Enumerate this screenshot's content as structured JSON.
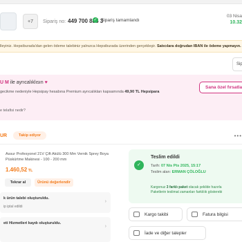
{
  "order": {
    "more_count": "+7",
    "order_no_label": "Sipariş no:",
    "order_no": "449 700 885 3",
    "status": "Sipariş tamamlandı",
    "date": "03 Nisa",
    "time": "10.32"
  },
  "notice": {
    "text_normal": "lleyiniz. Hepsiburada'dan gelen ödeme talebiniz yalnızca Hepsiburada üzerinden gerçekleşir. ",
    "text_bold": "Satıcılara doğrudan IBAN ile ödeme yapmayın."
  },
  "side_button": "Sip",
  "premium": {
    "title_highlight": "U M",
    "title_rest": " ile ayrıcalıklısın",
    "heart": "♥",
    "desc_normal": "gecikme nedeniyle Hepsipay hesabına Premium ayrıcalıkları kapsamında ",
    "desc_bold": "49,90 TL Hepsipara",
    "link": "e telafisi nedir?",
    "offer_button": "Sana özel fırsatla"
  },
  "seller": {
    "name": "UR",
    "follow": "Takip ediyor",
    "more": "•••"
  },
  "product": {
    "name": "Assur Profesyonel 21V Çift Akülü 300 Mm Vernik Sprey Boya Püskürtme Makinesi - 100 - 200 mm",
    "price": "1.460,52",
    "currency": " TL",
    "repeat_button": "Tekrar al",
    "rate_button": "Ürünü değerlendir"
  },
  "claims": [
    {
      "title": "k ürün talebi oluşturuldu.",
      "sub": "ip iptal edildi",
      "arrow": "›"
    },
    {
      "title": "eti Hizmetleri kaydı oluşturuldu.",
      "sub": "",
      "arrow": "›"
    }
  ],
  "delivery": {
    "title": "Teslim edildi",
    "date_label": "Tarih: ",
    "date_value": "07 Nis Pts 2025, 15:17",
    "receiver_label": "Teslim alan: ",
    "receiver_value": "ERMAN ÇÖLOĞLU",
    "note_pre": "Kargonuz ",
    "note_bold": "3 farklı paket",
    "note_post": " olacak şekilde hazırla",
    "note2": "Paketlerin teslimat zamanları farklılık gösterebi"
  },
  "actions": {
    "cargo": "Kargo takibi",
    "invoice": "Fatura bilgisi",
    "returns": "İade ve diğer talepler"
  },
  "colors": {
    "accent": "#f27a1a",
    "success": "#2fb55b",
    "premium": "#d0337f"
  }
}
